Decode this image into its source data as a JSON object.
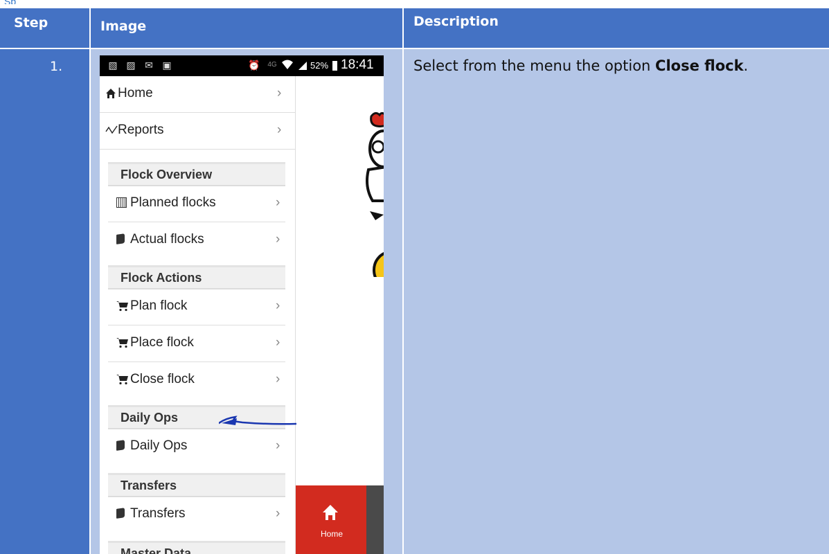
{
  "table": {
    "headers": {
      "step": "Step",
      "image": "Image",
      "description": "Description"
    },
    "rows": [
      {
        "step": "1.",
        "description_prefix": "Select from the menu the option ",
        "description_bold": "Close flock",
        "description_suffix": "."
      }
    ]
  },
  "stub_text": "Sp",
  "phone": {
    "status_bar": {
      "battery": "52%",
      "time": "18:41",
      "icons": [
        "gallery-icon",
        "gallery-icon",
        "mail-icon",
        "app-icon",
        "alarm-icon",
        "network-4g-icon",
        "wifi-icon",
        "signal-icon",
        "battery-icon"
      ]
    },
    "menu": {
      "top_items": [
        {
          "label": "Home",
          "icon": "home-icon"
        },
        {
          "label": "Reports",
          "icon": "chart-line-icon"
        }
      ],
      "sections": [
        {
          "title": "Flock Overview",
          "items": [
            {
              "label": "Planned flocks",
              "icon": "calendar-icon"
            },
            {
              "label": "Actual flocks",
              "icon": "book-icon"
            }
          ]
        },
        {
          "title": "Flock Actions",
          "items": [
            {
              "label": "Plan flock",
              "icon": "cart-icon"
            },
            {
              "label": "Place flock",
              "icon": "cart-icon"
            },
            {
              "label": "Close flock",
              "icon": "cart-icon"
            }
          ]
        },
        {
          "title": "Daily Ops",
          "items": [
            {
              "label": "Daily Ops",
              "icon": "book-icon"
            }
          ]
        },
        {
          "title": "Transfers",
          "items": [
            {
              "label": "Transfers",
              "icon": "book-icon"
            }
          ]
        },
        {
          "title": "Master Data",
          "items": []
        }
      ],
      "chevron": "›"
    },
    "bottom_nav": {
      "home_label": "Home"
    }
  },
  "colors": {
    "header_blue": "#4472c4",
    "cell_light": "#b4c6e7",
    "home_red": "#d22b1f"
  }
}
